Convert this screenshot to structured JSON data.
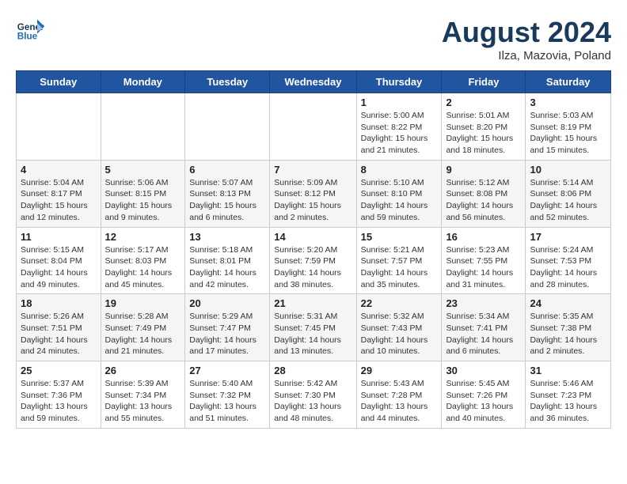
{
  "header": {
    "logo_line1": "General",
    "logo_line2": "Blue",
    "month": "August 2024",
    "location": "Ilza, Mazovia, Poland"
  },
  "days_of_week": [
    "Sunday",
    "Monday",
    "Tuesday",
    "Wednesday",
    "Thursday",
    "Friday",
    "Saturday"
  ],
  "weeks": [
    [
      {
        "day": "",
        "info": ""
      },
      {
        "day": "",
        "info": ""
      },
      {
        "day": "",
        "info": ""
      },
      {
        "day": "",
        "info": ""
      },
      {
        "day": "1",
        "info": "Sunrise: 5:00 AM\nSunset: 8:22 PM\nDaylight: 15 hours\nand 21 minutes."
      },
      {
        "day": "2",
        "info": "Sunrise: 5:01 AM\nSunset: 8:20 PM\nDaylight: 15 hours\nand 18 minutes."
      },
      {
        "day": "3",
        "info": "Sunrise: 5:03 AM\nSunset: 8:19 PM\nDaylight: 15 hours\nand 15 minutes."
      }
    ],
    [
      {
        "day": "4",
        "info": "Sunrise: 5:04 AM\nSunset: 8:17 PM\nDaylight: 15 hours\nand 12 minutes."
      },
      {
        "day": "5",
        "info": "Sunrise: 5:06 AM\nSunset: 8:15 PM\nDaylight: 15 hours\nand 9 minutes."
      },
      {
        "day": "6",
        "info": "Sunrise: 5:07 AM\nSunset: 8:13 PM\nDaylight: 15 hours\nand 6 minutes."
      },
      {
        "day": "7",
        "info": "Sunrise: 5:09 AM\nSunset: 8:12 PM\nDaylight: 15 hours\nand 2 minutes."
      },
      {
        "day": "8",
        "info": "Sunrise: 5:10 AM\nSunset: 8:10 PM\nDaylight: 14 hours\nand 59 minutes."
      },
      {
        "day": "9",
        "info": "Sunrise: 5:12 AM\nSunset: 8:08 PM\nDaylight: 14 hours\nand 56 minutes."
      },
      {
        "day": "10",
        "info": "Sunrise: 5:14 AM\nSunset: 8:06 PM\nDaylight: 14 hours\nand 52 minutes."
      }
    ],
    [
      {
        "day": "11",
        "info": "Sunrise: 5:15 AM\nSunset: 8:04 PM\nDaylight: 14 hours\nand 49 minutes."
      },
      {
        "day": "12",
        "info": "Sunrise: 5:17 AM\nSunset: 8:03 PM\nDaylight: 14 hours\nand 45 minutes."
      },
      {
        "day": "13",
        "info": "Sunrise: 5:18 AM\nSunset: 8:01 PM\nDaylight: 14 hours\nand 42 minutes."
      },
      {
        "day": "14",
        "info": "Sunrise: 5:20 AM\nSunset: 7:59 PM\nDaylight: 14 hours\nand 38 minutes."
      },
      {
        "day": "15",
        "info": "Sunrise: 5:21 AM\nSunset: 7:57 PM\nDaylight: 14 hours\nand 35 minutes."
      },
      {
        "day": "16",
        "info": "Sunrise: 5:23 AM\nSunset: 7:55 PM\nDaylight: 14 hours\nand 31 minutes."
      },
      {
        "day": "17",
        "info": "Sunrise: 5:24 AM\nSunset: 7:53 PM\nDaylight: 14 hours\nand 28 minutes."
      }
    ],
    [
      {
        "day": "18",
        "info": "Sunrise: 5:26 AM\nSunset: 7:51 PM\nDaylight: 14 hours\nand 24 minutes."
      },
      {
        "day": "19",
        "info": "Sunrise: 5:28 AM\nSunset: 7:49 PM\nDaylight: 14 hours\nand 21 minutes."
      },
      {
        "day": "20",
        "info": "Sunrise: 5:29 AM\nSunset: 7:47 PM\nDaylight: 14 hours\nand 17 minutes."
      },
      {
        "day": "21",
        "info": "Sunrise: 5:31 AM\nSunset: 7:45 PM\nDaylight: 14 hours\nand 13 minutes."
      },
      {
        "day": "22",
        "info": "Sunrise: 5:32 AM\nSunset: 7:43 PM\nDaylight: 14 hours\nand 10 minutes."
      },
      {
        "day": "23",
        "info": "Sunrise: 5:34 AM\nSunset: 7:41 PM\nDaylight: 14 hours\nand 6 minutes."
      },
      {
        "day": "24",
        "info": "Sunrise: 5:35 AM\nSunset: 7:38 PM\nDaylight: 14 hours\nand 2 minutes."
      }
    ],
    [
      {
        "day": "25",
        "info": "Sunrise: 5:37 AM\nSunset: 7:36 PM\nDaylight: 13 hours\nand 59 minutes."
      },
      {
        "day": "26",
        "info": "Sunrise: 5:39 AM\nSunset: 7:34 PM\nDaylight: 13 hours\nand 55 minutes."
      },
      {
        "day": "27",
        "info": "Sunrise: 5:40 AM\nSunset: 7:32 PM\nDaylight: 13 hours\nand 51 minutes."
      },
      {
        "day": "28",
        "info": "Sunrise: 5:42 AM\nSunset: 7:30 PM\nDaylight: 13 hours\nand 48 minutes."
      },
      {
        "day": "29",
        "info": "Sunrise: 5:43 AM\nSunset: 7:28 PM\nDaylight: 13 hours\nand 44 minutes."
      },
      {
        "day": "30",
        "info": "Sunrise: 5:45 AM\nSunset: 7:26 PM\nDaylight: 13 hours\nand 40 minutes."
      },
      {
        "day": "31",
        "info": "Sunrise: 5:46 AM\nSunset: 7:23 PM\nDaylight: 13 hours\nand 36 minutes."
      }
    ]
  ]
}
